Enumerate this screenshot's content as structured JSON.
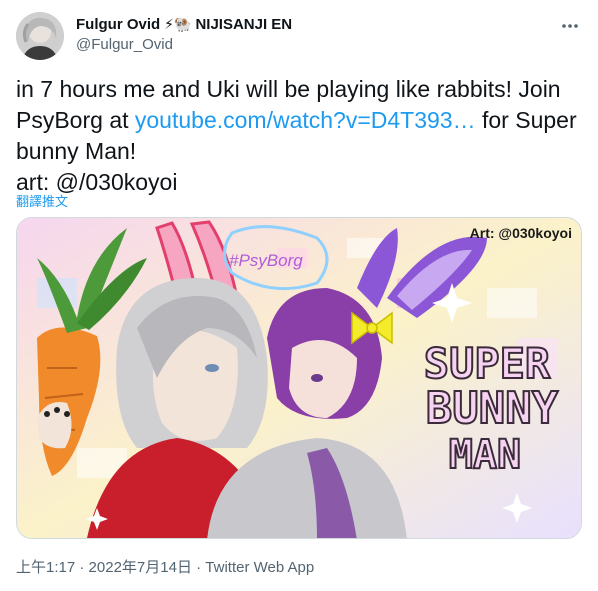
{
  "author": {
    "display_name": "Fulgur Ovid",
    "emojis": "⚡🐏",
    "affiliation": "NIJISANJI EN",
    "handle": "@Fulgur_Ovid"
  },
  "tweet": {
    "text_before": "in 7 hours me and Uki will be playing like rabbits! Join PsyBorg at ",
    "link": "youtube.com/watch?v=D4T393…",
    "text_after": " for Super bunny Man!\nart: @/030koyoi",
    "translate_label": "翻譯推文"
  },
  "media": {
    "art_credit": "Art: @030koyoi",
    "hashtag": "#PsyBorg",
    "title_line1": "SUPER",
    "title_line2": "BUNNY",
    "title_line3": "MAN"
  },
  "meta": {
    "time": "上午1:17",
    "date": "2022年7月14日",
    "source": "Twitter Web App",
    "separator": " · "
  },
  "icons": {
    "more": "more-horizontal-icon"
  }
}
